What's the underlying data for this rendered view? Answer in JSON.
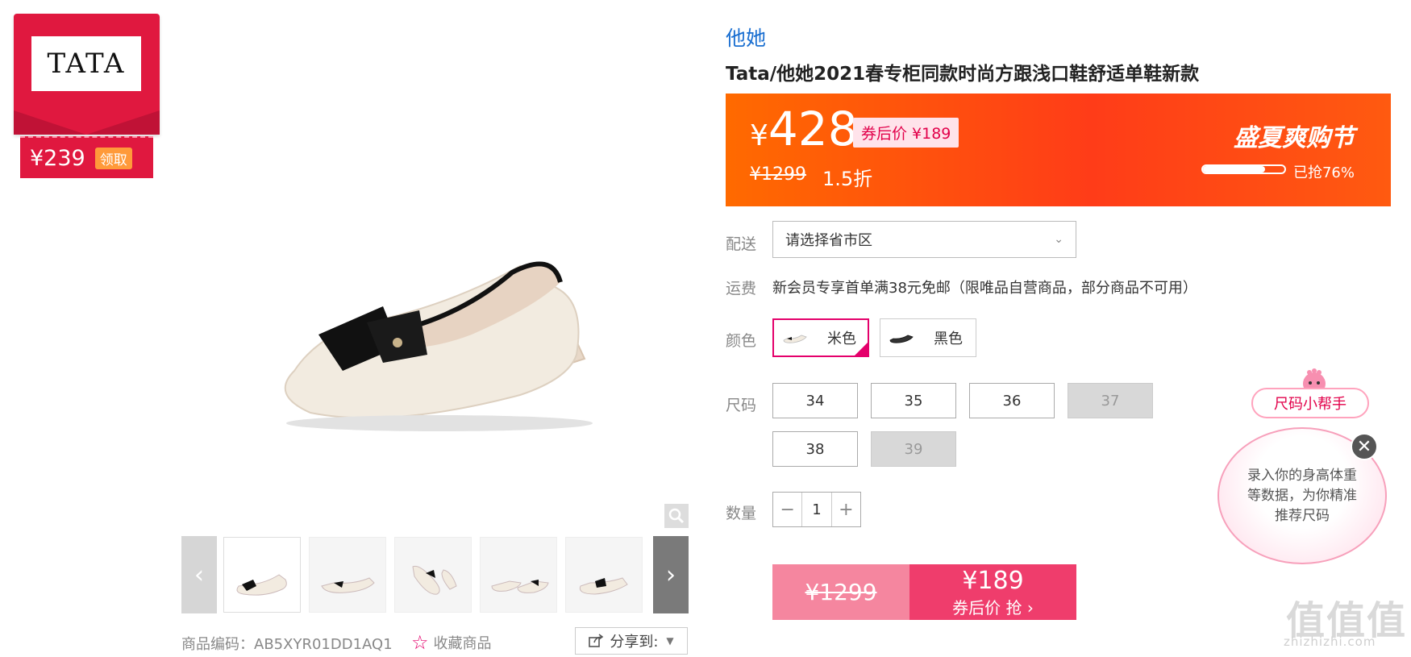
{
  "coupon": {
    "brand_logo": "TATA",
    "price": "¥239",
    "get_label": "领取"
  },
  "gallery": {
    "zoom_icon": "magnifier-icon",
    "prev_icon": "chevron-left-icon",
    "next_icon": "chevron-right-icon",
    "thumbnails": [
      "beige-side",
      "beige-front",
      "beige-top",
      "beige-pair",
      "beige-angle"
    ],
    "sku_code": "商品编码：AB5XYR01DD1AQ1",
    "favorite_label": "收藏商品",
    "share_label": "分享到:"
  },
  "product": {
    "brand": "他她",
    "title": "Tata/他她2021春专柜同款时尚方跟浅口鞋舒适单鞋新款"
  },
  "promo": {
    "yen": "¥",
    "price": "428",
    "coupon_price_label": "券后价 ¥189",
    "original_price": "¥1299",
    "discount": "1.5折",
    "event_name": "盛夏爽购节",
    "sold_percent": 76,
    "sold_label": "已抢76%",
    "colors": {
      "start": "#ff6a00",
      "end": "#ff3c18"
    }
  },
  "delivery": {
    "label": "配送",
    "placeholder": "请选择省市区"
  },
  "shipping": {
    "label": "运费",
    "text": "新会员专享首单满38元免邮（限唯品自营商品，部分商品不可用）"
  },
  "color": {
    "label": "颜色",
    "options": [
      {
        "name": "米色",
        "selected": true
      },
      {
        "name": "黑色",
        "selected": false
      }
    ]
  },
  "size": {
    "label": "尺码",
    "options": [
      {
        "value": "34",
        "available": true
      },
      {
        "value": "35",
        "available": true
      },
      {
        "value": "36",
        "available": true
      },
      {
        "value": "37",
        "available": false
      },
      {
        "value": "38",
        "available": true
      },
      {
        "value": "39",
        "available": false
      }
    ]
  },
  "quantity": {
    "label": "数量",
    "value": "1",
    "minus": "−",
    "plus": "+"
  },
  "buy": {
    "original_price": "¥1299",
    "coupon_price": "¥189",
    "action_label": "券后价 抢 ›"
  },
  "size_helper": {
    "title": "尺码小帮手",
    "message": "录入你的身高体重等数据，为你精准推荐尺码",
    "close": "✕"
  },
  "watermark": {
    "main": "值值值",
    "sub": "zhizhizhi.com"
  },
  "accent_color": "#e4006b"
}
